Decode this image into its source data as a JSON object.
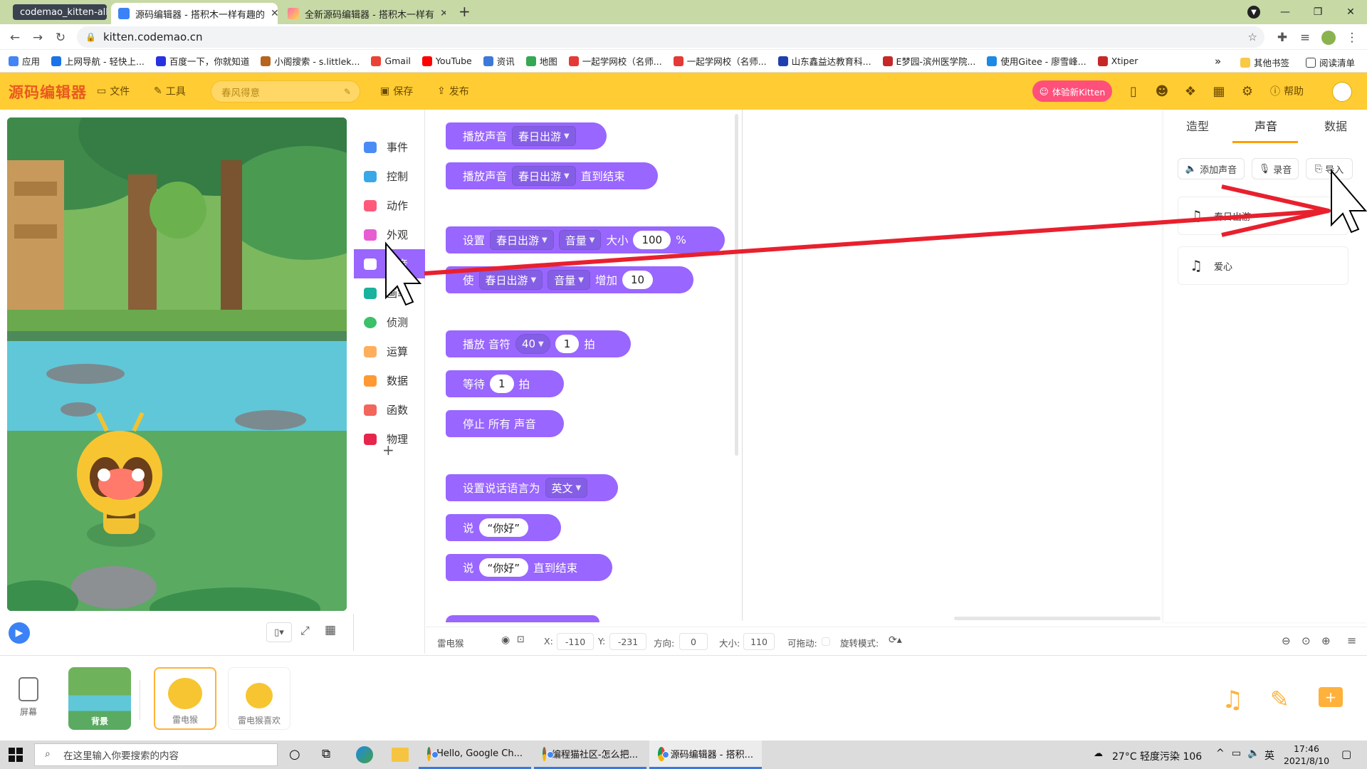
{
  "browser": {
    "tabs": [
      {
        "label": "codemao_kitten-all\\"
      },
      {
        "label": "源码编辑器 - 搭积木一样有趣的"
      },
      {
        "label": "全新源码编辑器 - 搭积木一样有"
      }
    ],
    "new_tab": "+",
    "url": "kitten.codemao.cn",
    "bookmarks": [
      {
        "label": "应用",
        "color": "#4285f4"
      },
      {
        "label": "上网导航 - 轻快上...",
        "color": "#1a73e8"
      },
      {
        "label": "百度一下，你就知道",
        "color": "#2932e1"
      },
      {
        "label": "小阁搜索 - s.littlek...",
        "color": "#b5651d"
      },
      {
        "label": "Gmail",
        "color": "#ea4335"
      },
      {
        "label": "YouTube",
        "color": "#ff0000"
      },
      {
        "label": "资讯",
        "color": "#3c78d8"
      },
      {
        "label": "地图",
        "color": "#34a853"
      },
      {
        "label": "一起学网校（名师...",
        "color": "#e53935"
      },
      {
        "label": "一起学网校（名师...",
        "color": "#e53935"
      },
      {
        "label": "山东鑫益达教育科...",
        "color": "#1e40af"
      },
      {
        "label": "E梦园-滨州医学院...",
        "color": "#c62828"
      },
      {
        "label": "使用Gitee - 廖雪峰...",
        "color": "#1e88e5"
      },
      {
        "label": "Xtiper",
        "color": "#c62828"
      }
    ],
    "more_bookmarks": "»",
    "other_bookmarks": "其他书签",
    "reading_list": "阅读清单"
  },
  "toolbar": {
    "logo": "源码编辑器",
    "file": "文件",
    "tools": "工具",
    "project_name": "春风得意",
    "save": "保存",
    "publish": "发布",
    "try_new": "体验新Kitten",
    "help": "帮助"
  },
  "categories": [
    {
      "label": "事件",
      "color": "#4b8bf5"
    },
    {
      "label": "控制",
      "color": "#3aa7e8"
    },
    {
      "label": "动作",
      "color": "#ff5a7a"
    },
    {
      "label": "外观",
      "color": "#e85cd2"
    },
    {
      "label": "声音",
      "color": "#ffffff"
    },
    {
      "label": "画笔",
      "color": "#18b29d"
    },
    {
      "label": "侦测",
      "color": "#3cc06a"
    },
    {
      "label": "运算",
      "color": "#ffae5c"
    },
    {
      "label": "数据",
      "color": "#ff9933"
    },
    {
      "label": "函数",
      "color": "#f2665c"
    },
    {
      "label": "物理",
      "color": "#e6264d"
    }
  ],
  "add_category": "+",
  "blocks": {
    "b1": {
      "t1": "播放声音",
      "d1": "春日出游"
    },
    "b2": {
      "t1": "播放声音",
      "d1": "春日出游",
      "t2": "直到结束"
    },
    "b3": {
      "t1": "设置",
      "d1": "春日出游",
      "d2": "音量",
      "t2": "大小",
      "n1": "100",
      "t3": "%"
    },
    "b4": {
      "t1": "使",
      "d1": "春日出游",
      "d2": "音量",
      "t2": "增加",
      "n1": "10"
    },
    "b5": {
      "t1": "播放 音符",
      "d1": "40",
      "n1": "1",
      "t2": "拍"
    },
    "b6": {
      "t1": "等待",
      "n1": "1",
      "t2": "拍"
    },
    "b7": {
      "t1": "停止 所有 声音"
    },
    "b8": {
      "t1": "设置说话语言为",
      "d1": "英文"
    },
    "b9": {
      "t1": "说",
      "n1": "“你好”"
    },
    "b10": {
      "t1": "说",
      "n1": "“你好”",
      "t2": "直到结束"
    }
  },
  "right_panel": {
    "tabs": [
      "造型",
      "声音",
      "数据"
    ],
    "add_sound": "添加声音",
    "record": "录音",
    "import": "导入",
    "sounds": [
      "春日出游",
      "爱心"
    ]
  },
  "status": {
    "sprite_name": "雷电猴",
    "x_label": "X:",
    "x": "-110",
    "y_label": "Y:",
    "y": "-231",
    "dir_label": "方向:",
    "dir": "0",
    "size_label": "大小:",
    "size": "110",
    "drag_label": "可拖动:",
    "rotate_label": "旋转模式:"
  },
  "spritebar": {
    "screen": "屏幕",
    "sprites": [
      "背景",
      "雷电猴",
      "雷电猴喜欢"
    ]
  },
  "taskbar": {
    "search_placeholder": "在这里输入你要搜索的内容",
    "apps": [
      "Hello, Google Ch...",
      "编程猫社区-怎么把...",
      "源码编辑器 - 搭积..."
    ],
    "weather": "27°C  轻度污染 106",
    "ime": "英",
    "time": "17:46",
    "date": "2021/8/10"
  }
}
